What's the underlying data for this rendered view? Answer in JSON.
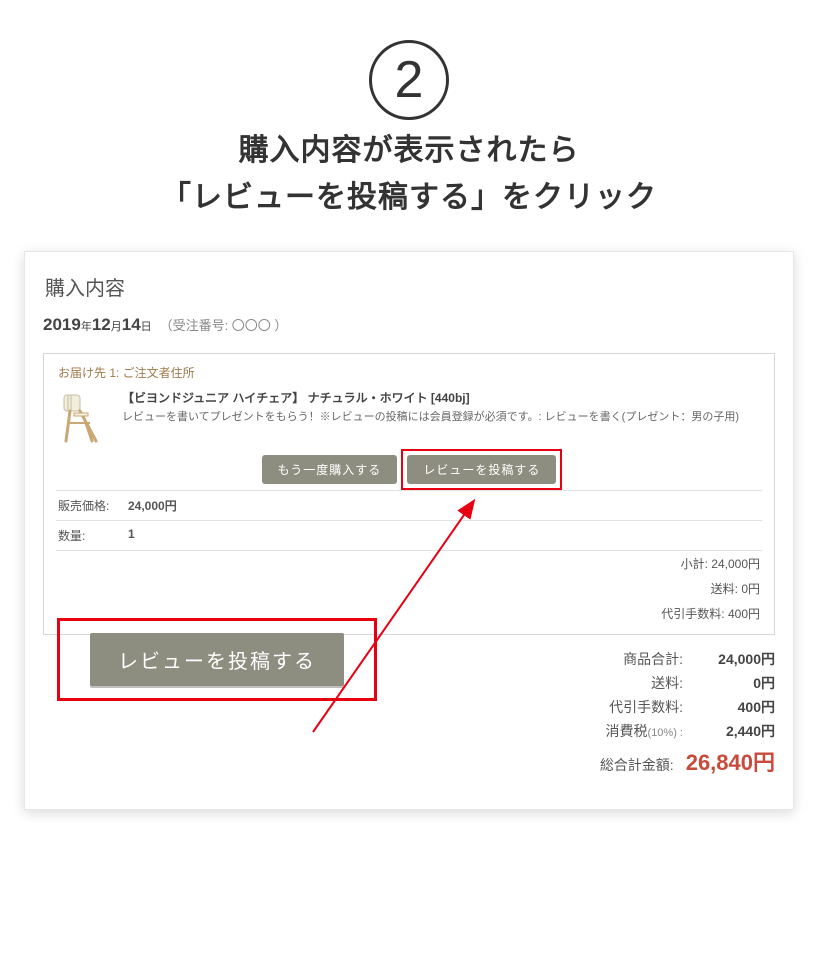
{
  "step_number": "2",
  "headline_line1": "購入内容が表示されたら",
  "headline_line2": "「レビューを投稿する」をクリック",
  "section_title": "購入内容",
  "order_date": {
    "year": "2019",
    "year_unit": "年",
    "month": "12",
    "month_unit": "月",
    "day": "14",
    "day_unit": "日"
  },
  "order_id_label": "（受注番号: 〇〇〇 ）",
  "ship_to": "お届け先 1: ご注文者住所",
  "item": {
    "title": "【ビヨンドジュニア ハイチェア】 ナチュラル・ホワイト [440bj]",
    "desc": "レビューを書いてプレゼントをもらう！※レビューの投稿には会員登録が必須です。: レビューを書く(プレゼント：男の子用)"
  },
  "buttons": {
    "buy_again": "もう一度購入する",
    "post_review_small": "レビューを投稿する"
  },
  "detail_rows": {
    "price_label": "販売価格:",
    "price_value": "24,000円",
    "qty_label": "数量:",
    "qty_value": "1"
  },
  "inner_totals": {
    "subtotal": "小計: 24,000円",
    "shipping": "送料: 0円",
    "cod_fee": "代引手数料: 400円"
  },
  "outer_totals": {
    "goods_label": "商品合計:",
    "goods_val": "24,000円",
    "shipping_label": "送料:",
    "shipping_val": "0円",
    "cod_label": "代引手数料:",
    "cod_val": "400円",
    "tax_label": "消費税",
    "tax_sub": "(10%) :",
    "tax_val": "2,440円",
    "grand_label": "総合計金額:",
    "grand_val": "26,840円"
  },
  "big_button": "レビューを投稿する"
}
